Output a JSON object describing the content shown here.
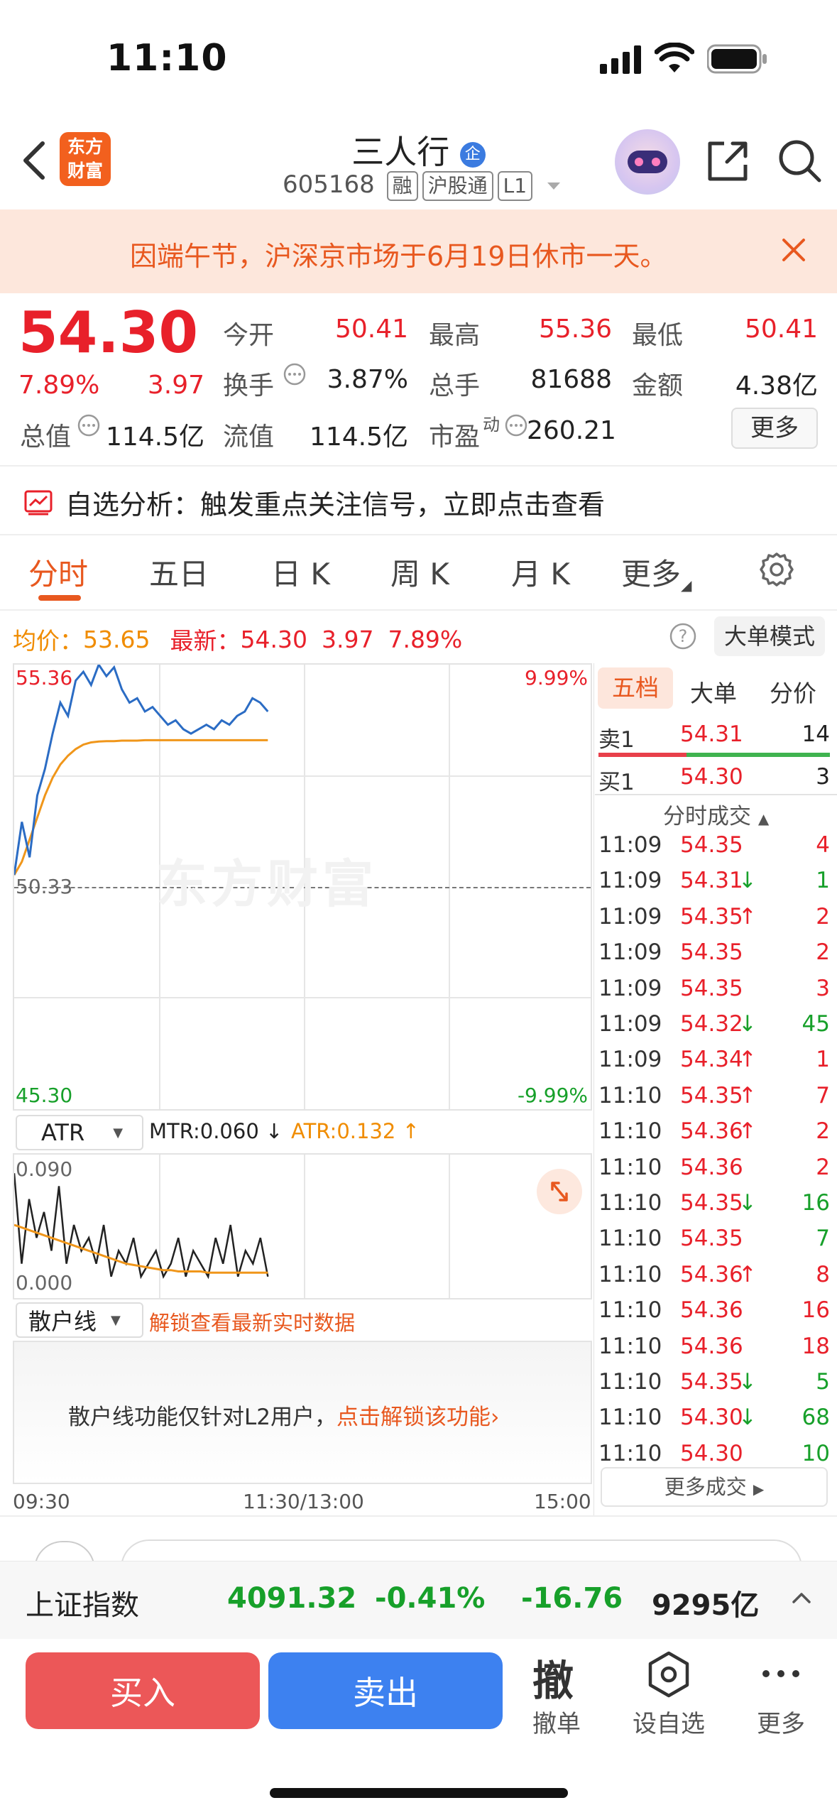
{
  "status_bar": {
    "time": "11:10"
  },
  "header": {
    "logo_line1": "东方",
    "logo_line2": "财富",
    "stock_name": "三人行",
    "name_badge": "企",
    "stock_code": "605168",
    "tags": [
      "融",
      "沪股通",
      "L1"
    ]
  },
  "banner": {
    "text": "因端午节，沪深京市场于6月19日休市一天。"
  },
  "quote": {
    "price": "54.30",
    "change_pct": "7.89%",
    "change": "3.97",
    "fields": [
      {
        "label": "今开",
        "value": "50.41",
        "color": "red"
      },
      {
        "label": "最高",
        "value": "55.36",
        "color": "red"
      },
      {
        "label": "最低",
        "value": "50.41",
        "color": "red"
      },
      {
        "label": "换手",
        "value": "3.87%",
        "color": "dark"
      },
      {
        "label": "总手",
        "value": "81688",
        "color": "dark"
      },
      {
        "label": "金额",
        "value": "4.38亿",
        "color": "dark"
      },
      {
        "label": "总值",
        "value": "114.5亿",
        "color": "dark"
      },
      {
        "label": "流值",
        "value": "114.5亿",
        "color": "dark"
      },
      {
        "label": "市盈",
        "value": "260.21",
        "color": "dark"
      }
    ],
    "pe_superscript": "动",
    "more_button": "更多"
  },
  "analysis": {
    "text": "自选分析：触发重点关注信号，立即点击查看"
  },
  "tabs": [
    "分时",
    "五日",
    "日 K",
    "周 K",
    "月 K",
    "更多"
  ],
  "active_tab": "分时",
  "summary": {
    "avg_label": "均价：",
    "avg_value": "53.65",
    "latest_label": "最新：",
    "latest_value": "54.30",
    "latest_change": "3.97",
    "latest_pct": "7.89%",
    "big_order_button": "大单模式"
  },
  "chart": {
    "y_top": "55.36",
    "y_mid": "50.33",
    "y_bottom": "45.30",
    "pct_top": "9.99%",
    "pct_bottom": "-9.99%",
    "watermark": "东方财富",
    "x_labels": [
      "09:30",
      "11:30/13:00",
      "15:00"
    ]
  },
  "chart_data": {
    "type": "line",
    "series": [],
    "x_range": [
      "09:30",
      "15:00"
    ],
    "ylim": [
      45.3,
      55.36
    ],
    "reference": 50.33
  },
  "price_series": [
    50.6,
    51.8,
    51.0,
    52.4,
    53.0,
    53.8,
    54.5,
    54.2,
    55.0,
    55.2,
    54.9,
    55.36,
    55.1,
    55.3,
    54.8,
    54.5,
    54.6,
    54.3,
    54.4,
    54.2,
    54.0,
    54.1,
    53.9,
    53.8,
    53.9,
    54.0,
    53.9,
    54.1,
    54.0,
    54.2,
    54.3,
    54.6,
    54.5,
    54.3
  ],
  "avg_series": [
    50.6,
    50.9,
    51.4,
    51.9,
    52.4,
    52.8,
    53.1,
    53.3,
    53.45,
    53.55,
    53.6,
    53.62,
    53.63,
    53.63,
    53.64,
    53.64,
    53.64,
    53.65,
    53.65,
    53.65,
    53.65,
    53.65,
    53.65,
    53.65,
    53.65,
    53.65,
    53.65,
    53.65,
    53.65,
    53.65,
    53.65,
    53.65,
    53.65,
    53.65
  ],
  "indicator": {
    "name": "ATR",
    "mtr_label": "MTR:0.060",
    "atr_label": "ATR:0.132",
    "y_top": "0.090",
    "y_bottom": "0.000",
    "mtr_series": [
      0.09,
      0.02,
      0.07,
      0.04,
      0.06,
      0.03,
      0.08,
      0.02,
      0.05,
      0.03,
      0.04,
      0.02,
      0.05,
      0.01,
      0.03,
      0.02,
      0.04,
      0.01,
      0.02,
      0.03,
      0.01,
      0.02,
      0.04,
      0.01,
      0.03,
      0.02,
      0.01,
      0.04,
      0.02,
      0.05,
      0.01,
      0.03,
      0.02,
      0.04,
      0.01
    ],
    "atr_series": [
      0.05,
      0.048,
      0.046,
      0.044,
      0.042,
      0.04,
      0.038,
      0.036,
      0.034,
      0.032,
      0.03,
      0.028,
      0.026,
      0.024,
      0.022,
      0.02,
      0.019,
      0.018,
      0.017,
      0.016,
      0.015,
      0.015,
      0.014,
      0.014,
      0.014,
      0.014,
      0.013,
      0.013,
      0.013,
      0.013,
      0.013,
      0.013,
      0.013,
      0.013,
      0.013
    ]
  },
  "retail": {
    "name": "散户线",
    "unlock_hint": "解锁查看最新实时数据",
    "notice": "散户线功能仅针对L2用户，",
    "notice_link": "点击解锁该功能"
  },
  "order_book": {
    "tabs": [
      "五档",
      "大单",
      "分价"
    ],
    "sell": {
      "label": "卖1",
      "price": "54.31",
      "vol": "14"
    },
    "buy": {
      "label": "买1",
      "price": "54.30",
      "vol": "3"
    },
    "ticks_title": "分时成交",
    "ticks": [
      {
        "t": "11:09",
        "p": "54.35",
        "dir": "",
        "v": "4",
        "vc": "red"
      },
      {
        "t": "11:09",
        "p": "54.31",
        "dir": "down",
        "v": "1",
        "vc": "green"
      },
      {
        "t": "11:09",
        "p": "54.35",
        "dir": "up",
        "v": "2",
        "vc": "red"
      },
      {
        "t": "11:09",
        "p": "54.35",
        "dir": "",
        "v": "2",
        "vc": "red"
      },
      {
        "t": "11:09",
        "p": "54.35",
        "dir": "",
        "v": "3",
        "vc": "red"
      },
      {
        "t": "11:09",
        "p": "54.32",
        "dir": "down",
        "v": "45",
        "vc": "green"
      },
      {
        "t": "11:09",
        "p": "54.34",
        "dir": "up",
        "v": "1",
        "vc": "red"
      },
      {
        "t": "11:10",
        "p": "54.35",
        "dir": "up",
        "v": "7",
        "vc": "red"
      },
      {
        "t": "11:10",
        "p": "54.36",
        "dir": "up",
        "v": "2",
        "vc": "red"
      },
      {
        "t": "11:10",
        "p": "54.36",
        "dir": "",
        "v": "2",
        "vc": "red"
      },
      {
        "t": "11:10",
        "p": "54.35",
        "dir": "down",
        "v": "16",
        "vc": "green"
      },
      {
        "t": "11:10",
        "p": "54.35",
        "dir": "",
        "v": "7",
        "vc": "green"
      },
      {
        "t": "11:10",
        "p": "54.36",
        "dir": "up",
        "v": "8",
        "vc": "red"
      },
      {
        "t": "11:10",
        "p": "54.36",
        "dir": "",
        "v": "16",
        "vc": "red"
      },
      {
        "t": "11:10",
        "p": "54.36",
        "dir": "",
        "v": "18",
        "vc": "red"
      },
      {
        "t": "11:10",
        "p": "54.35",
        "dir": "down",
        "v": "5",
        "vc": "green"
      },
      {
        "t": "11:10",
        "p": "54.30",
        "dir": "down",
        "v": "68",
        "vc": "green"
      },
      {
        "t": "11:10",
        "p": "54.30",
        "dir": "",
        "v": "10",
        "vc": "green"
      }
    ],
    "more_ticks": "更多成交"
  },
  "index_bar": {
    "name": "上证指数",
    "value": "4091.32",
    "pct": "-0.41%",
    "change": "-16.76",
    "amount": "9295亿"
  },
  "actions": {
    "buy": "买入",
    "sell": "卖出",
    "cancel_glyph": "撤",
    "cancel": "撤单",
    "watch": "设自选",
    "more": "更多"
  },
  "colors": {
    "up": "#e8202a",
    "down": "#17a02a",
    "accent": "#e8581f",
    "line": "#2b6cc4",
    "avg": "#f0961a"
  }
}
